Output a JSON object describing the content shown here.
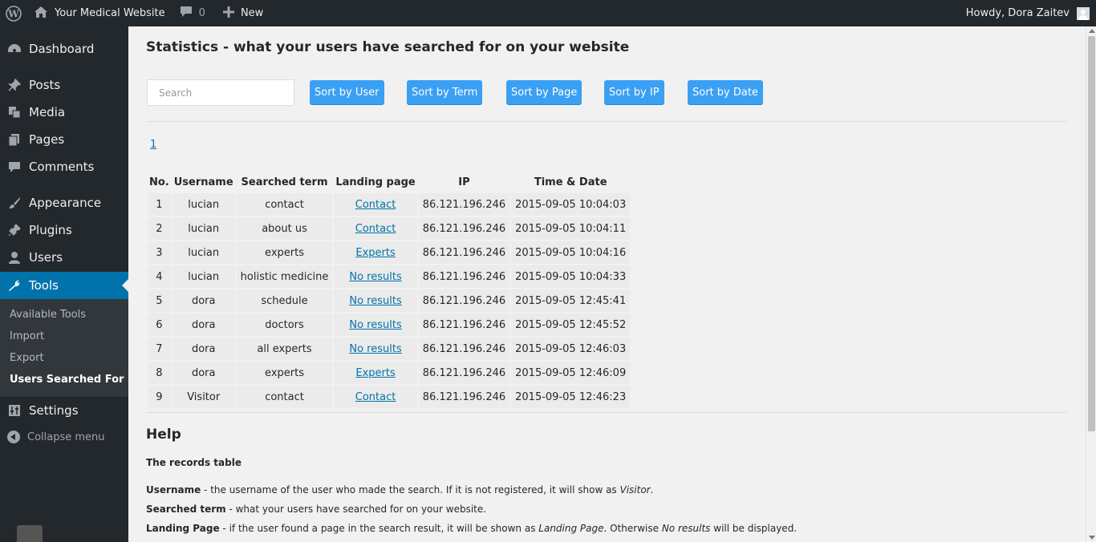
{
  "adminbar": {
    "site_name": "Your Medical Website",
    "comment_count": "0",
    "new_label": "New",
    "greeting": "Howdy, Dora Zaitev"
  },
  "sidebar": {
    "items": [
      {
        "label": "Dashboard",
        "icon": "dashboard-icon"
      },
      {
        "label": "Posts",
        "icon": "pin-icon"
      },
      {
        "label": "Media",
        "icon": "media-icon"
      },
      {
        "label": "Pages",
        "icon": "pages-icon"
      },
      {
        "label": "Comments",
        "icon": "comment-icon"
      },
      {
        "label": "Appearance",
        "icon": "brush-icon"
      },
      {
        "label": "Plugins",
        "icon": "plug-icon"
      },
      {
        "label": "Users",
        "icon": "user-icon"
      },
      {
        "label": "Tools",
        "icon": "wrench-icon"
      },
      {
        "label": "Settings",
        "icon": "sliders-icon"
      }
    ],
    "submenu": [
      "Available Tools",
      "Import",
      "Export",
      "Users Searched For"
    ],
    "collapse_label": "Collapse menu"
  },
  "main": {
    "title": "Statistics - what your users have searched for on your website",
    "search_placeholder": "Search",
    "sort_buttons": [
      "Sort by User",
      "Sort by Term",
      "Sort by Page",
      "Sort by IP",
      "Sort by Date"
    ],
    "page_link": "1",
    "table": {
      "headers": [
        "No.",
        "Username",
        "Searched term",
        "Landing page",
        "IP",
        "Time & Date"
      ],
      "rows": [
        [
          "1",
          "lucian",
          "contact",
          "Contact",
          "86.121.196.246",
          "2015-09-05 10:04:03"
        ],
        [
          "2",
          "lucian",
          "about us",
          "Contact",
          "86.121.196.246",
          "2015-09-05 10:04:11"
        ],
        [
          "3",
          "lucian",
          "experts",
          "Experts",
          "86.121.196.246",
          "2015-09-05 10:04:16"
        ],
        [
          "4",
          "lucian",
          "holistic medicine",
          "No results",
          "86.121.196.246",
          "2015-09-05 10:04:33"
        ],
        [
          "5",
          "dora",
          "schedule",
          "No results",
          "86.121.196.246",
          "2015-09-05 12:45:41"
        ],
        [
          "6",
          "dora",
          "doctors",
          "No results",
          "86.121.196.246",
          "2015-09-05 12:45:52"
        ],
        [
          "7",
          "dora",
          "all experts",
          "No results",
          "86.121.196.246",
          "2015-09-05 12:46:03"
        ],
        [
          "8",
          "dora",
          "experts",
          "Experts",
          "86.121.196.246",
          "2015-09-05 12:46:09"
        ],
        [
          "9",
          "Visitor",
          "contact",
          "Contact",
          "86.121.196.246",
          "2015-09-05 12:46:23"
        ]
      ]
    },
    "help": {
      "heading": "Help",
      "subheading": "The records table",
      "lines": [
        {
          "term": "Username",
          "text": " - the username of the user who made the search. If it is not registered, it will show as ",
          "em": "Visitor",
          "tail": "."
        },
        {
          "term": "Searched term",
          "text": " - what your users have searched for on your website.",
          "em": "",
          "tail": ""
        },
        {
          "term": "Landing Page",
          "text": " - if the user found a page in the search result, it will be shown as ",
          "em": "Landing Page",
          "tail": ". Otherwise ",
          "em2": "No results",
          "tail2": " will be displayed."
        }
      ]
    }
  },
  "colors": {
    "adminbar_bg": "#23282d",
    "accent": "#0073aa",
    "button": "#3aa0f3"
  }
}
